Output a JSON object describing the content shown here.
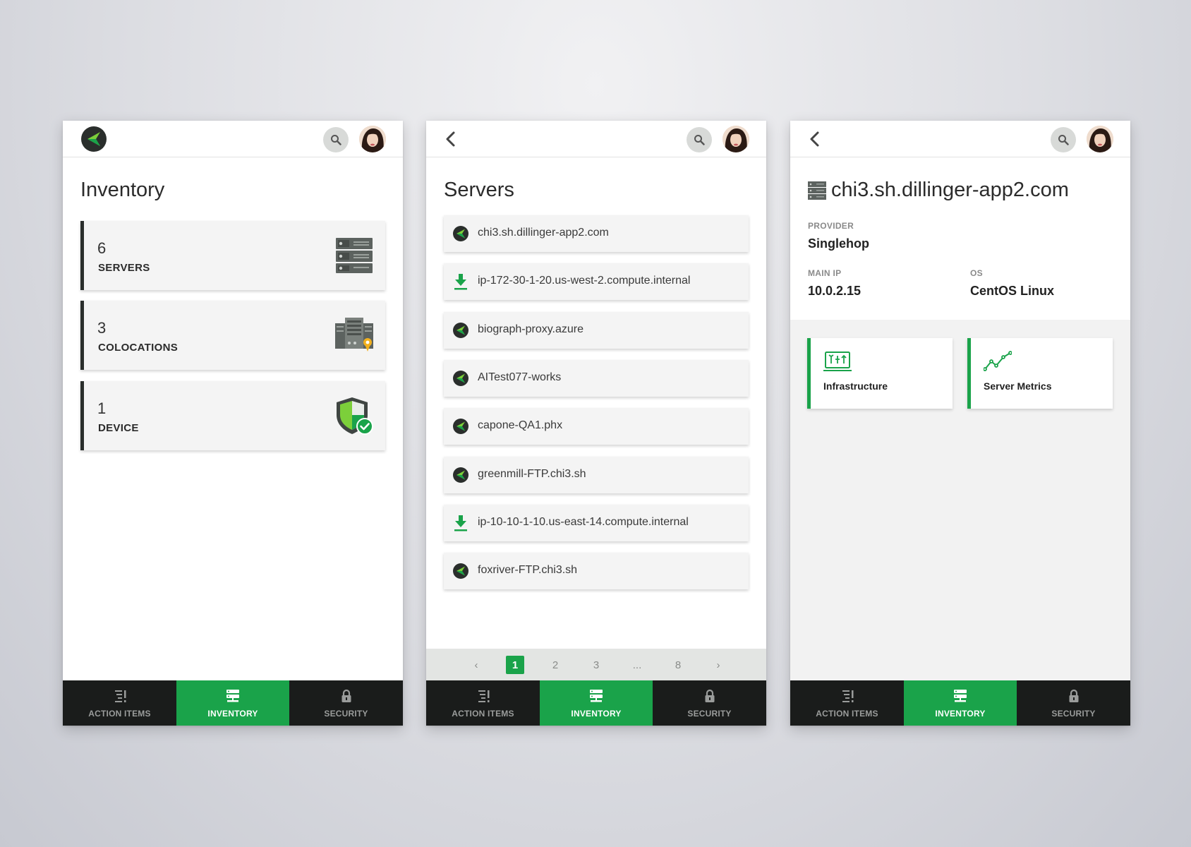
{
  "colors": {
    "accent": "#1aa34a",
    "nav_bg": "#1a1c1b",
    "card_border": "#2a2e2c"
  },
  "inventory": {
    "title": "Inventory",
    "cards": [
      {
        "count": "6",
        "label": "SERVERS",
        "icon": "server-rack-icon"
      },
      {
        "count": "3",
        "label": "COLOCATIONS",
        "icon": "colocation-icon"
      },
      {
        "count": "1",
        "label": "DEVICE",
        "icon": "shield-check-icon"
      }
    ]
  },
  "servers": {
    "title": "Servers",
    "items": [
      {
        "name": "chi3.sh.dillinger-app2.com",
        "icon": "logo-icon"
      },
      {
        "name": "ip-172-30-1-20.us-west-2.compute.internal",
        "icon": "download-icon"
      },
      {
        "name": "biograph-proxy.azure",
        "icon": "logo-icon"
      },
      {
        "name": "AITest077-works",
        "icon": "logo-icon"
      },
      {
        "name": "capone-QA1.phx",
        "icon": "logo-icon"
      },
      {
        "name": "greenmill-FTP.chi3.sh",
        "icon": "logo-icon"
      },
      {
        "name": "ip-10-10-1-10.us-east-14.compute.internal",
        "icon": "download-icon"
      },
      {
        "name": "foxriver-FTP.chi3.sh",
        "icon": "logo-icon"
      }
    ],
    "pagination": {
      "pages": [
        "1",
        "2",
        "3",
        "...",
        "8"
      ],
      "current": "1",
      "prev": "‹",
      "next": "›"
    }
  },
  "detail": {
    "title": "chi3.sh.dillinger-app2.com",
    "provider_label": "PROVIDER",
    "provider_value": "Singlehop",
    "main_ip_label": "MAIN IP",
    "main_ip_value": "10.0.2.15",
    "os_label": "OS",
    "os_value": "CentOS Linux",
    "tiles": [
      {
        "label": "Infrastructure",
        "icon": "infrastructure-icon"
      },
      {
        "label": "Server Metrics",
        "icon": "metrics-line-icon"
      }
    ]
  },
  "bottom_nav": {
    "items": [
      {
        "label": "ACTION ITEMS",
        "icon": "action-items-icon"
      },
      {
        "label": "INVENTORY",
        "icon": "inventory-icon"
      },
      {
        "label": "SECURITY",
        "icon": "lock-icon"
      }
    ],
    "active": "INVENTORY"
  }
}
